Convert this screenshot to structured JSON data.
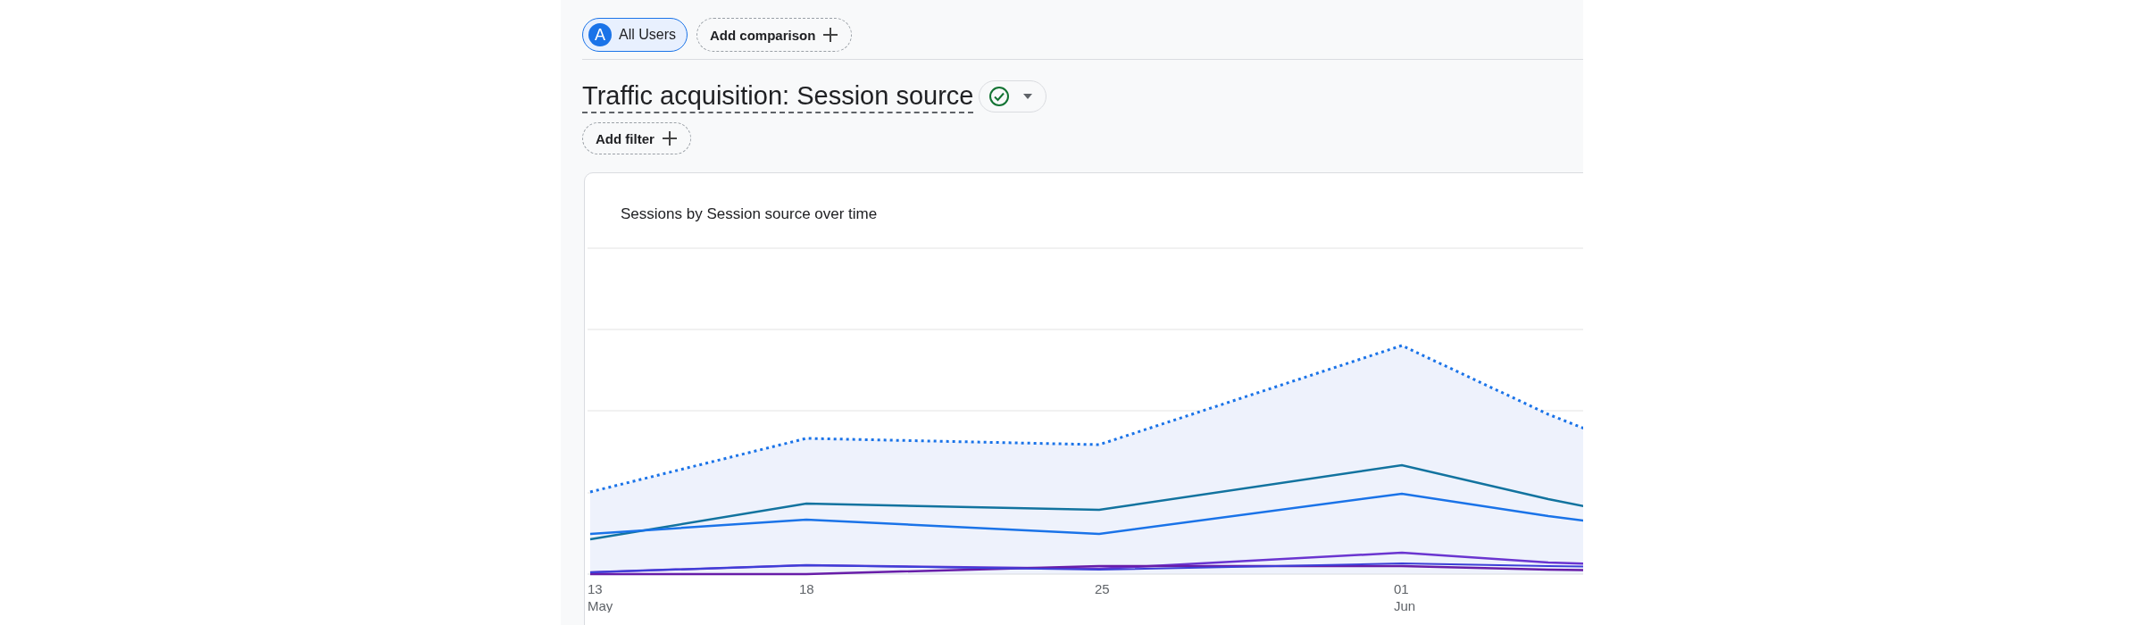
{
  "comparison_chips": [
    {
      "kind": "segment",
      "avatar": "A",
      "label": "All Users",
      "selected": true
    },
    {
      "kind": "add",
      "label": "Add comparison"
    }
  ],
  "report": {
    "title": "Traffic acquisition: Session source"
  },
  "add_filter_button": {
    "label": "Add filter"
  },
  "chart_card": {
    "title": "Sessions by Session source over time",
    "x_labels": [
      {
        "day": "13",
        "month": "May"
      },
      {
        "day": "18"
      },
      {
        "day": "25"
      },
      {
        "day": "01",
        "month": "Jun"
      }
    ]
  }
}
